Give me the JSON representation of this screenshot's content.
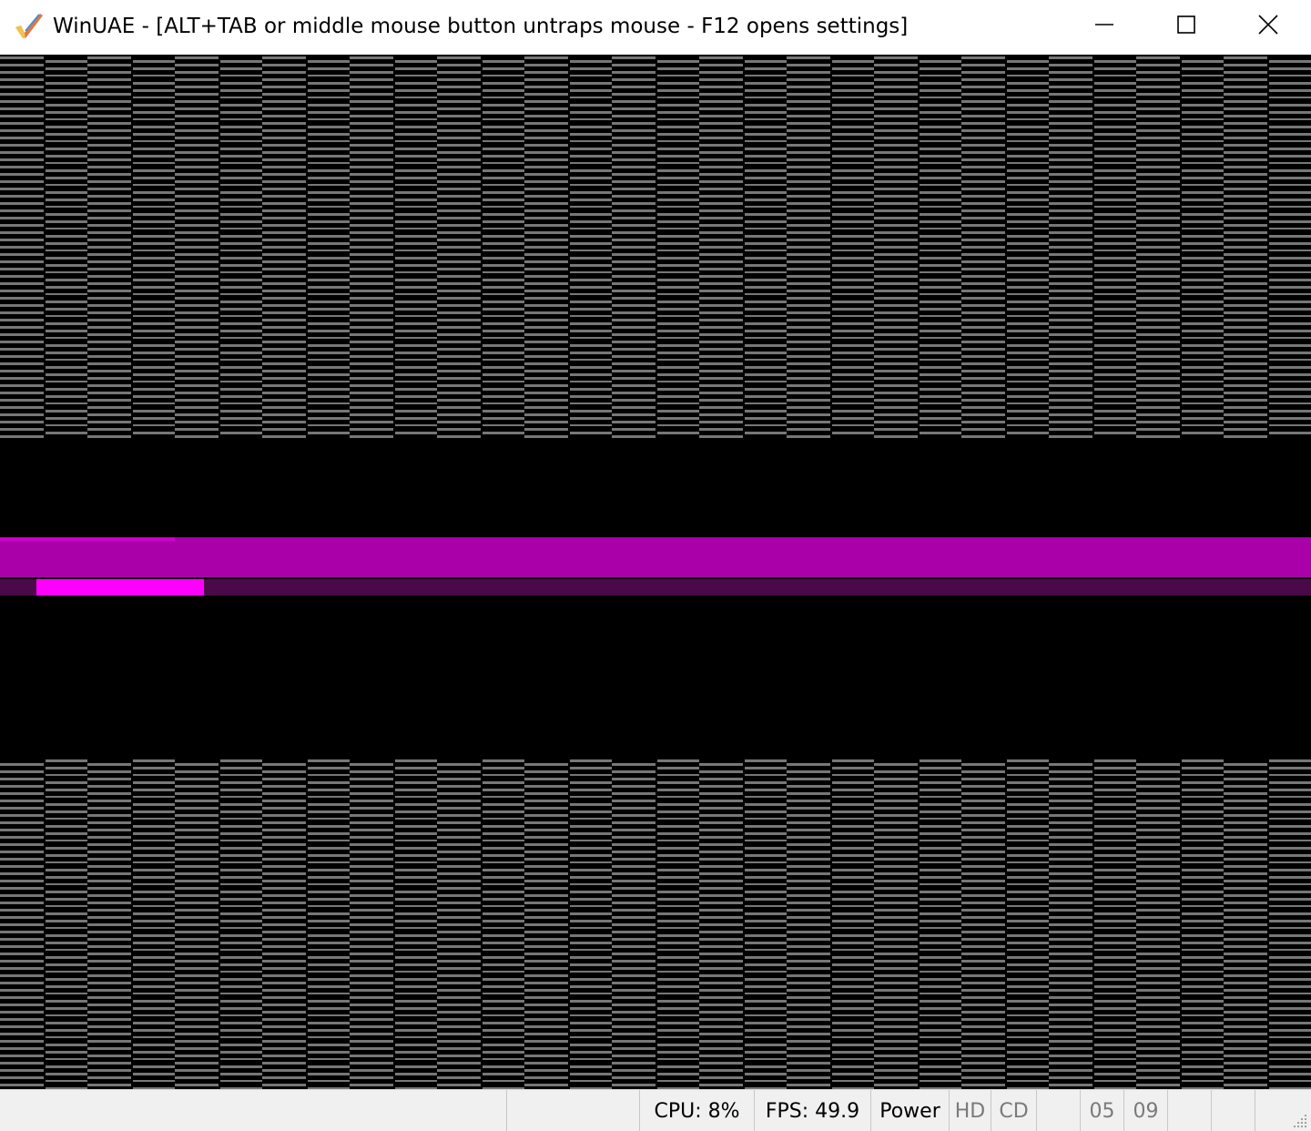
{
  "window": {
    "title": "WinUAE - [ALT+TAB or middle mouse button untraps mouse - F12 opens settings]",
    "app_icon": "winuae-checkmark-icon",
    "controls": {
      "minimize_icon": "minimize-icon",
      "maximize_icon": "maximize-icon",
      "close_icon": "close-icon"
    }
  },
  "display": {
    "description_colors": {
      "background": "#000000",
      "stripe": "#777777",
      "band_main": "#aa00aa",
      "band_top_highlight": "#cc00cc",
      "band_dark": "#4a0a4a",
      "band_bright": "#ff00ff"
    }
  },
  "statusbar": {
    "cpu": "CPU: 8%",
    "fps": "FPS: 49.9",
    "power": "Power",
    "hd": "HD",
    "cd": "CD",
    "drive_0": "05",
    "drive_1": "09",
    "resize_icon": "resize-grip-icon"
  }
}
